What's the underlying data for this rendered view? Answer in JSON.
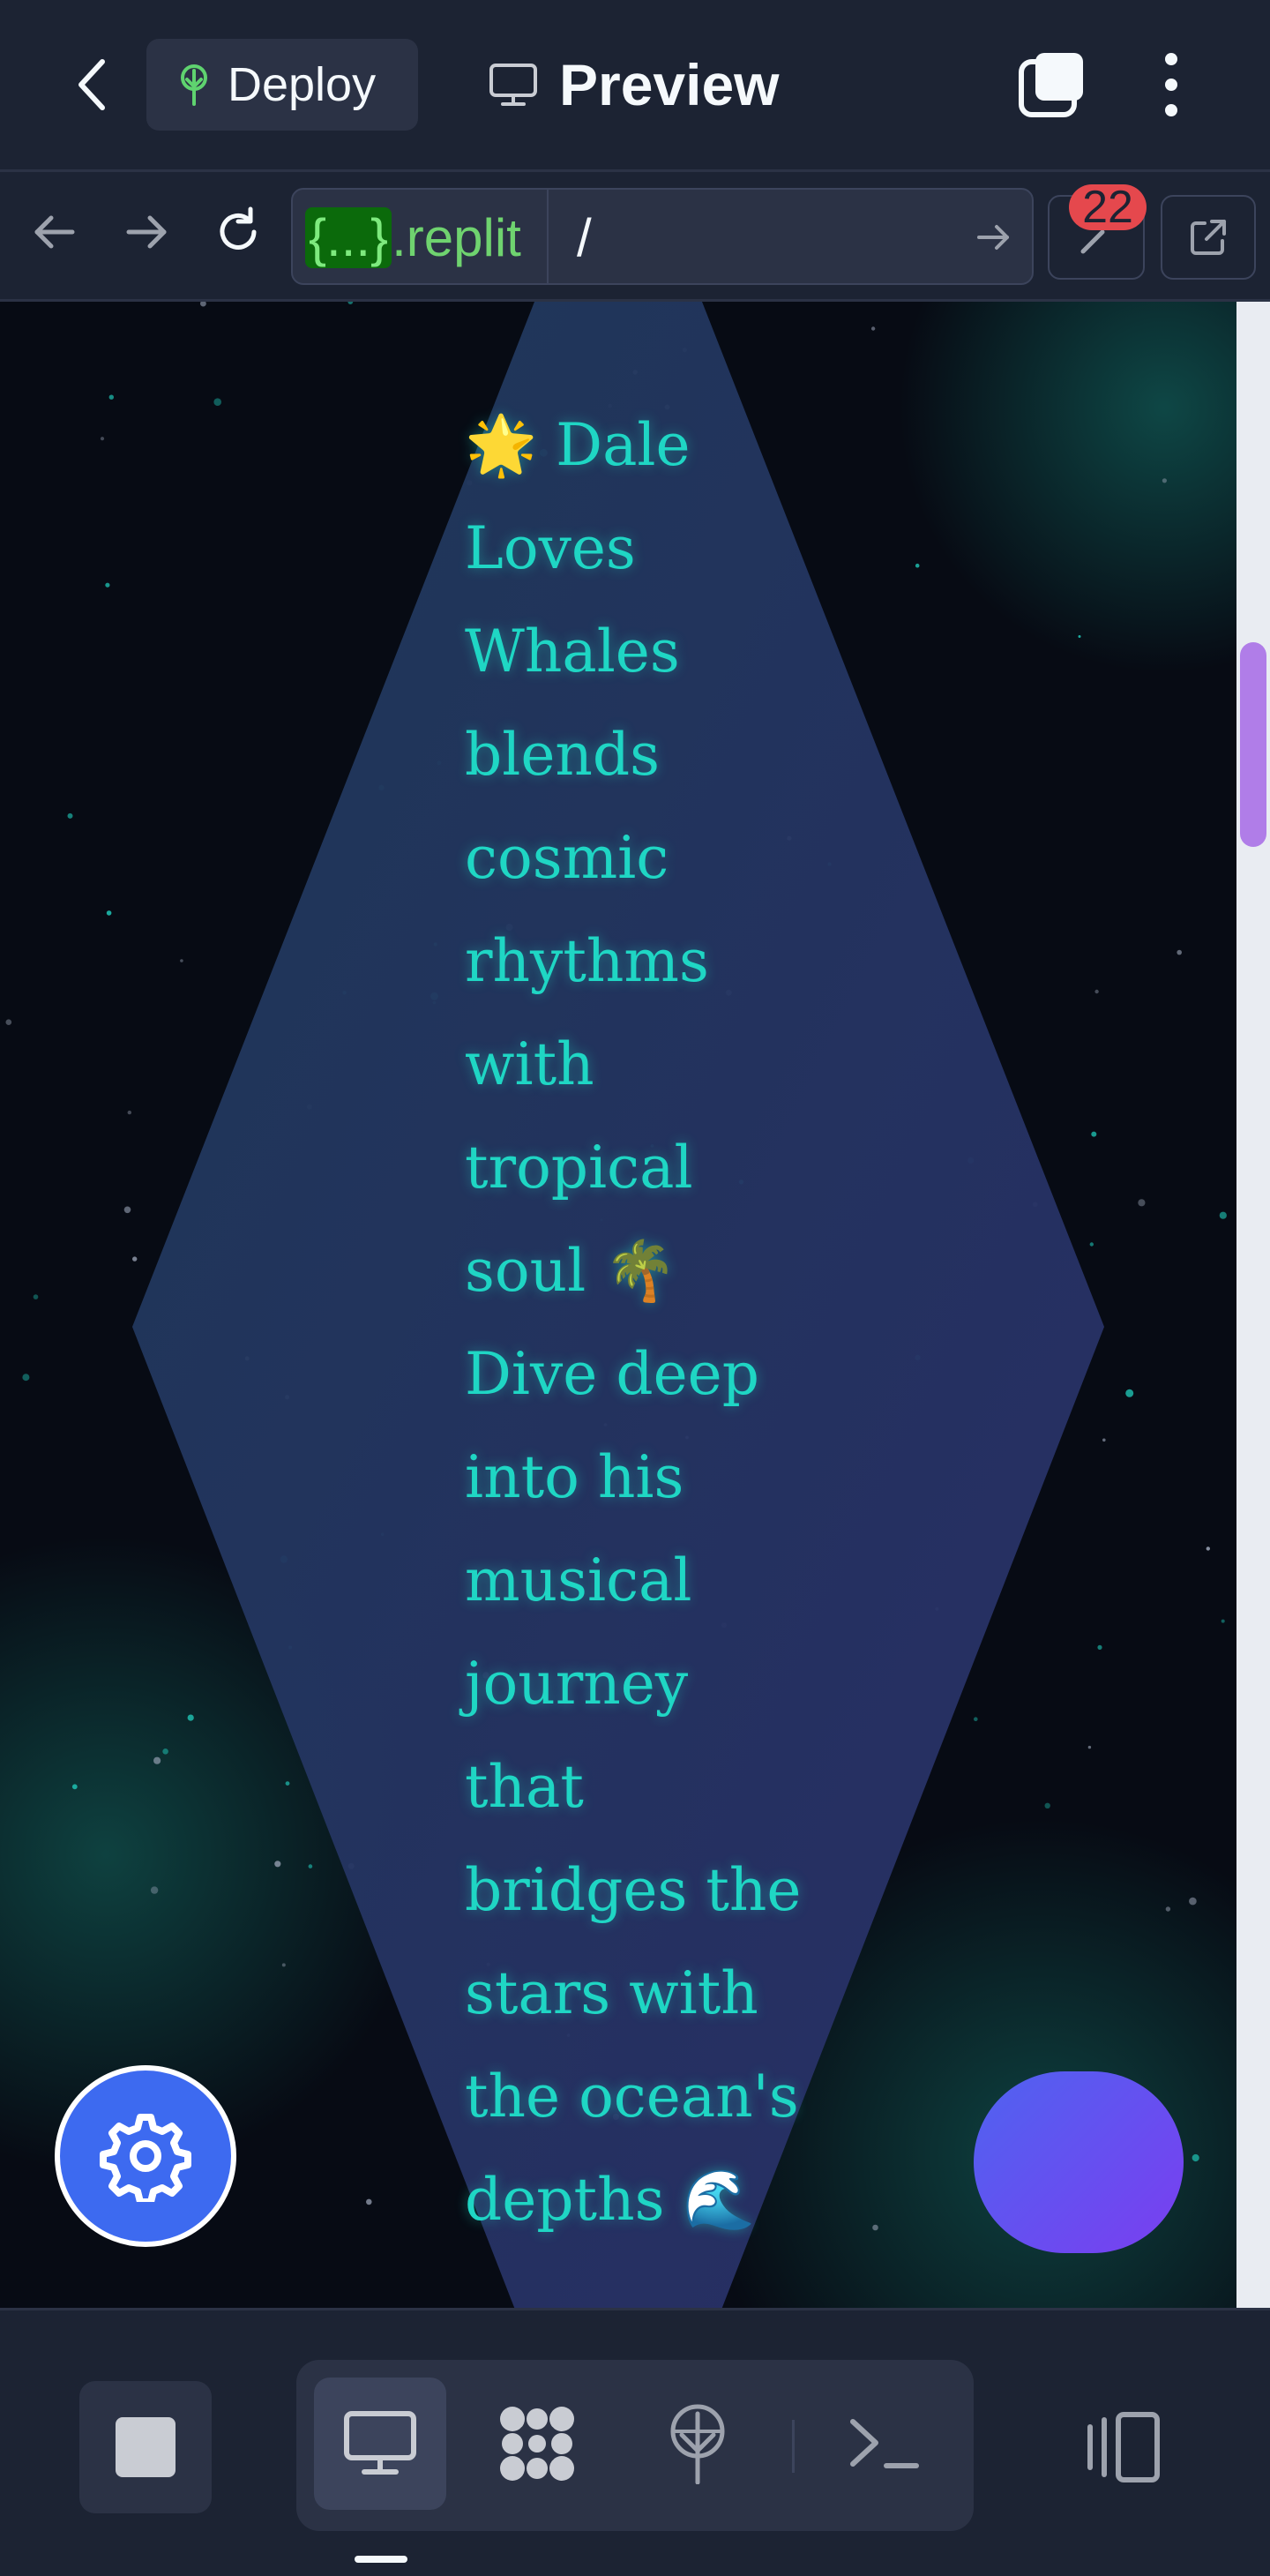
{
  "header": {
    "back_label": "Back",
    "deploy_label": "Deploy",
    "preview_label": "Preview"
  },
  "address_bar": {
    "host_brace": "{...}",
    "host_suffix": ".replit",
    "path": "/",
    "devtools_badge": "22"
  },
  "webpage": {
    "bio_lines": [
      "🌟 Dale",
      "Loves",
      "Whales",
      "blends",
      "cosmic",
      "rhythms",
      "with",
      "tropical",
      "soul 🌴",
      "Dive deep",
      "into his",
      "musical",
      "journey",
      "that",
      "bridges the",
      "stars with",
      "the ocean's",
      "depths 🌊"
    ]
  },
  "colors": {
    "app_bg": "#1c2333",
    "panel": "#2b3245",
    "accent_text": "#1fd6c4",
    "url_green": "#6fd36f",
    "badge_red": "#e5484d",
    "fab_blue": "#3d6af0",
    "scroll_thumb": "#b07de8"
  },
  "icons": {
    "back": "chevron-left-icon",
    "deploy": "deploy-tree-icon",
    "preview": "monitor-icon",
    "tabs": "tabs-icon",
    "more": "more-vertical-icon",
    "nav_back": "arrow-left-icon",
    "nav_forward": "arrow-right-icon",
    "reload": "reload-icon",
    "go": "arrow-right-icon",
    "devtools": "wrench-icon",
    "open_new_tab": "external-link-icon",
    "settings": "gear-icon",
    "stop": "stop-icon",
    "webview_tool": "monitor-icon",
    "workflow_tool": "apps-grid-icon",
    "deploy_tool": "deploy-tree-icon",
    "shell_tool": "terminal-icon",
    "panes": "panes-icon"
  }
}
